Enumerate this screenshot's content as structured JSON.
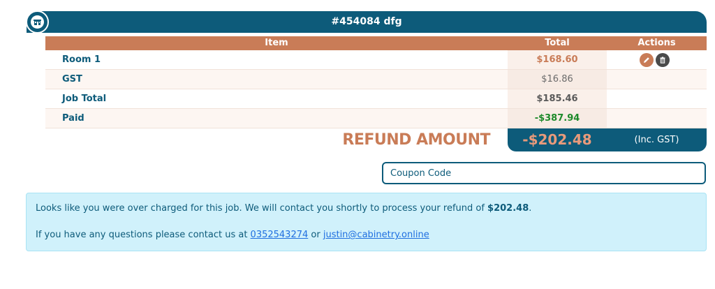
{
  "header": {
    "title": "#454084 dfg",
    "icon": "shop-icon"
  },
  "table": {
    "columns": {
      "item": "Item",
      "total": "Total",
      "actions": "Actions"
    },
    "rows": [
      {
        "label": "Room 1",
        "total": "$168.60",
        "total_color": "#c97c57",
        "actions": [
          "pencil-icon",
          "trash-icon"
        ]
      },
      {
        "label": "GST",
        "total": "$16.86",
        "total_color": "#6b6b6b"
      },
      {
        "label": "Job Total",
        "total": "$185.46",
        "total_color": "#6b6b6b"
      },
      {
        "label": "Paid",
        "total": "-$387.94",
        "total_color": "#1d8a2a"
      }
    ]
  },
  "refund": {
    "label": "REFUND AMOUNT",
    "value": "-$202.48",
    "gst_note": "(Inc. GST)"
  },
  "coupon": {
    "placeholder": "Coupon Code",
    "value": ""
  },
  "notice": {
    "line1_text": "Looks like you were over charged for this job. We will contact you shortly to process your refund of ",
    "line1_amount": "$202.48",
    "line1_end": ".",
    "line2_text": "If you have any questions please contact us at ",
    "phone": "0352543274",
    "or_text": " or ",
    "email": "justin@cabinetry.online"
  },
  "colors": {
    "primary": "#0d5b7a",
    "accent": "#c97c57",
    "notice_bg": "#d0f1fb"
  }
}
